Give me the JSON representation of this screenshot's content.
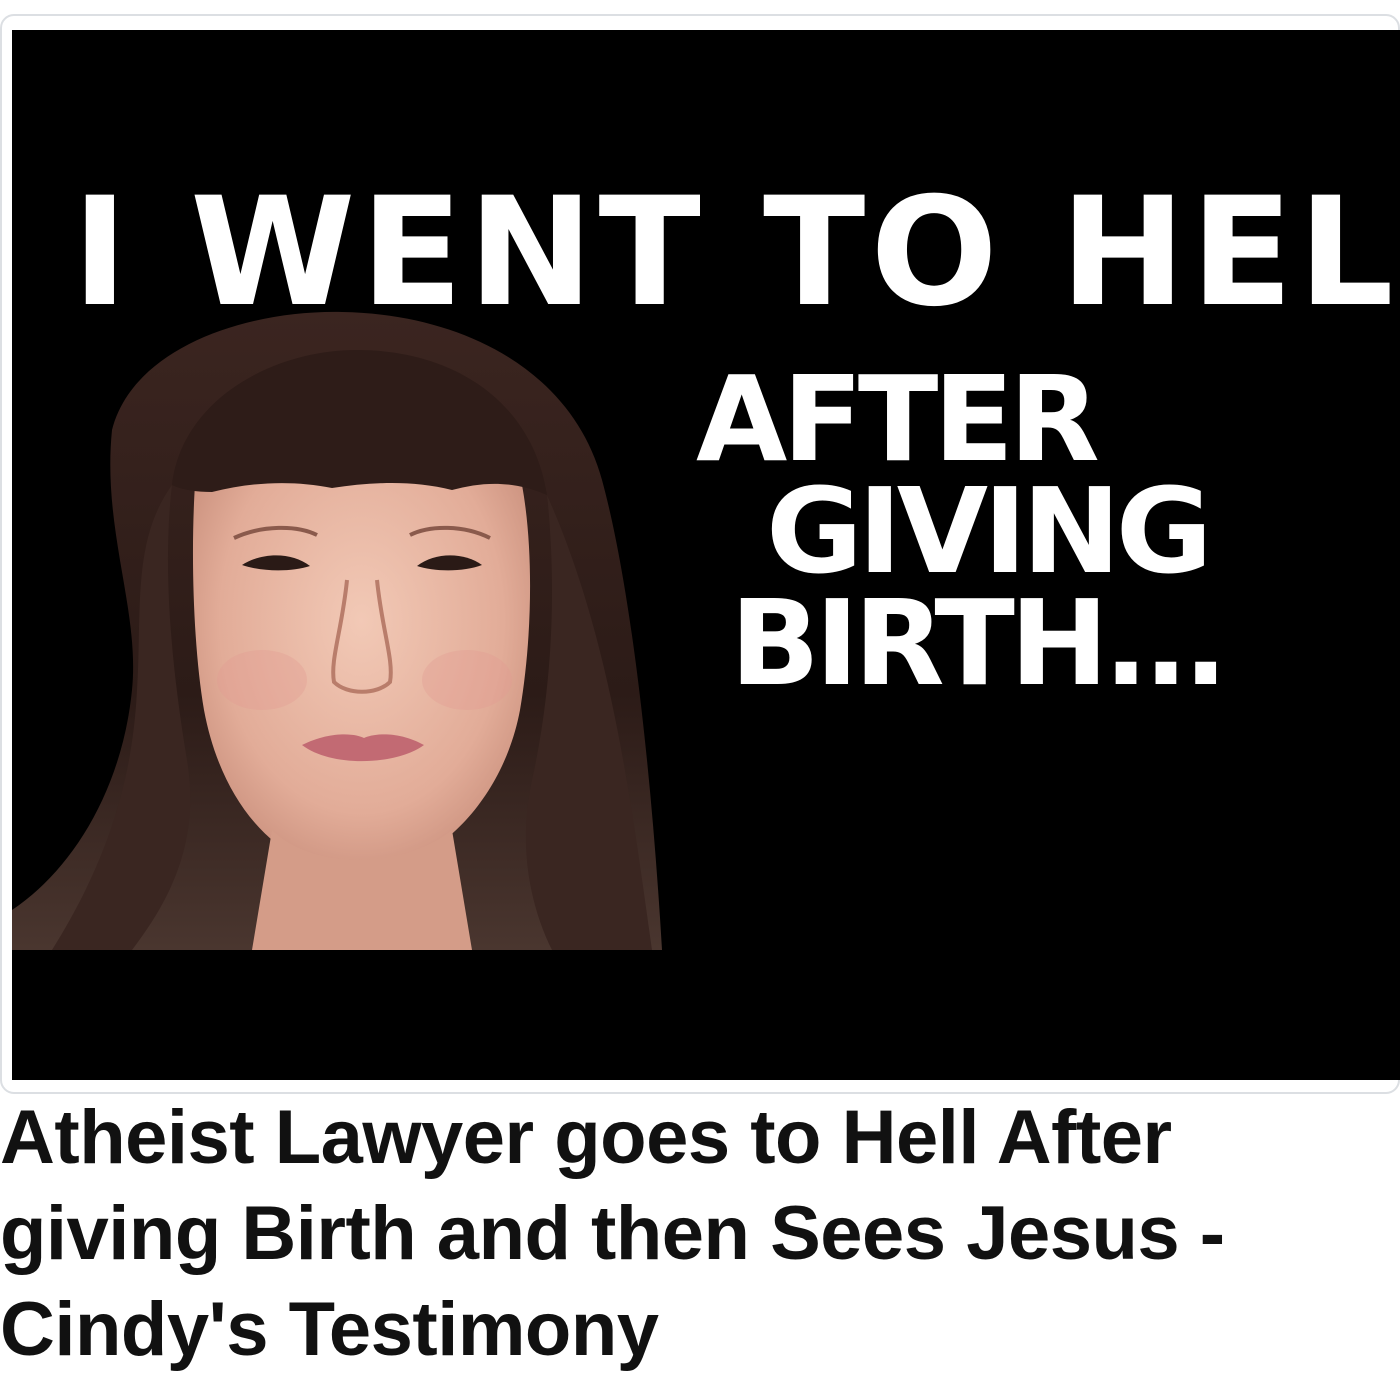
{
  "thumbnail": {
    "headline": "I WENT TO HELL",
    "subhead": [
      "AFTER",
      "GIVING",
      "BIRTH..."
    ],
    "background_color": "#000000",
    "text_color": "#ffffff"
  },
  "video": {
    "title_lines": [
      "Atheist Lawyer goes to Hell After",
      "giving Birth and then Sees Jesus -",
      "Cindy's Testimony"
    ]
  },
  "colors": {
    "frame_border": "#dcdfe3",
    "caption_text": "#111111"
  }
}
